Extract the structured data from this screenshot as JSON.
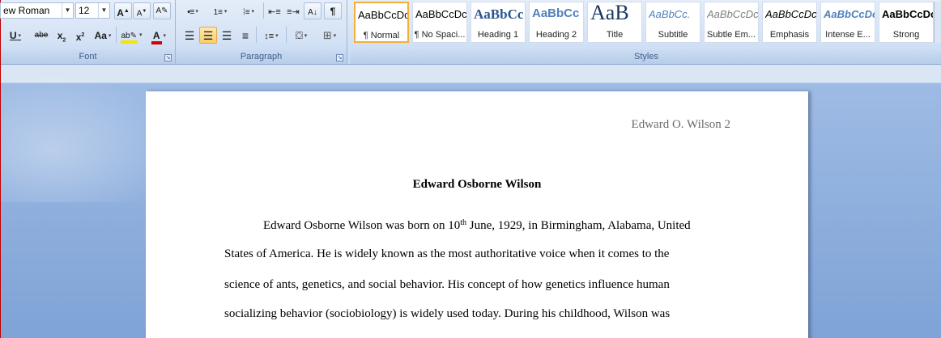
{
  "ribbon": {
    "font": {
      "name_value": "ew Roman",
      "size_value": "12",
      "group_label": "Font",
      "grow_label": "A",
      "shrink_label": "A",
      "clear_label": "A",
      "underline_label": "U",
      "strike_label": "abe",
      "subscript_label": "x",
      "superscript_label": "x",
      "case_label": "Aa",
      "highlight_label": "ab",
      "color_label": "A",
      "accent_highlight": "#f5e500",
      "accent_font_color": "#d40000"
    },
    "paragraph": {
      "group_label": "Paragraph",
      "pilcrow_label": "¶"
    },
    "styles": {
      "group_label": "Styles",
      "items": [
        {
          "preview": "AaBbCcDc",
          "name": "¶ Normal"
        },
        {
          "preview": "AaBbCcDc",
          "name": "¶ No Spaci..."
        },
        {
          "preview": "AaBbCc",
          "name": "Heading 1"
        },
        {
          "preview": "AaBbCc",
          "name": "Heading 2"
        },
        {
          "preview": "AaB",
          "name": "Title"
        },
        {
          "preview": "AaBbCc.",
          "name": "Subtitle"
        },
        {
          "preview": "AaBbCcDc",
          "name": "Subtle Em..."
        },
        {
          "preview": "AaBbCcDc",
          "name": "Emphasis"
        },
        {
          "preview": "AaBbCcDc",
          "name": "Intense E..."
        },
        {
          "preview": "AaBbCcDc",
          "name": "Strong"
        }
      ]
    }
  },
  "document": {
    "header": "Edward O. Wilson 2",
    "title": "Edward Osborne Wilson",
    "line1_before_sup": "Edward Osborne Wilson was born on 10",
    "line1_sup": "th",
    "line1_after_sup": " June, 1929, in Birmingham,  Alabama, United",
    "line2": "States of America.  He is  widely known as the most authoritative voice when it comes to the",
    "line3": "science of ants, genetics, and social behavior.  His concept of how genetics influence human",
    "line4": "socializing behavior (sociobiology)  is widely used today.  During his childhood, Wilson was"
  }
}
